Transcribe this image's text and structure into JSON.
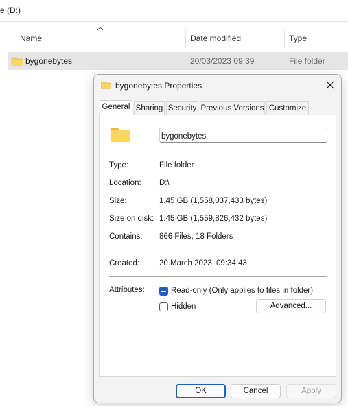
{
  "explorer": {
    "breadcrumb": "e (D:)",
    "columns": {
      "name": "Name",
      "date": "Date modified",
      "type": "Type"
    },
    "row": {
      "name": "bygonebytes",
      "date": "20/03/2023 09:39",
      "type": "File folder"
    }
  },
  "dialog": {
    "title": "bygonebytes Properties",
    "tabs": [
      "General",
      "Sharing",
      "Security",
      "Previous Versions",
      "Customize"
    ],
    "folder_name": "bygonebytes",
    "type_label": "Type:",
    "type_value": "File folder",
    "location_label": "Location:",
    "location_value": "D:\\",
    "size_label": "Size:",
    "size_value": "1.45 GB (1,558,037,433 bytes)",
    "disk_label": "Size on disk:",
    "disk_value": "1.45 GB (1,559,826,432 bytes)",
    "contains_label": "Contains:",
    "contains_value": "866 Files, 18 Folders",
    "created_label": "Created:",
    "created_value": "20 March 2023, 09:34:43",
    "attributes_label": "Attributes:",
    "readonly_label": "Read-only (Only applies to files in folder)",
    "hidden_label": "Hidden",
    "advanced_button": "Advanced...",
    "ok_button": "OK",
    "cancel_button": "Cancel",
    "apply_button": "Apply"
  },
  "colors": {
    "accent": "#1f5fbf",
    "folder": "#f8c948"
  }
}
